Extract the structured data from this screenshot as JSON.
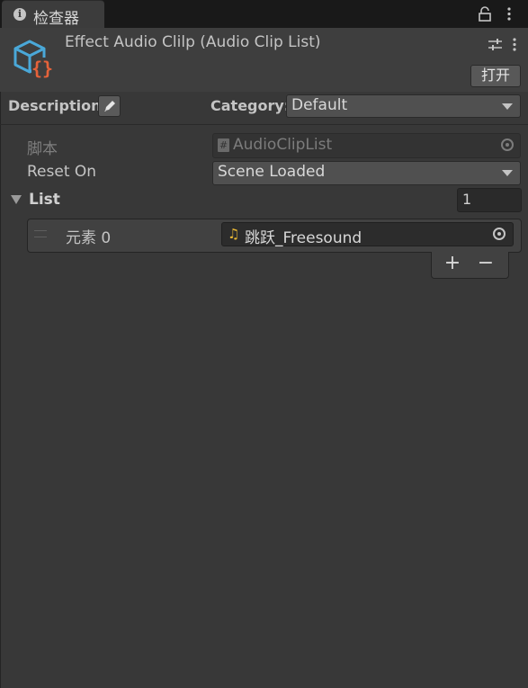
{
  "tab": {
    "label": "检查器",
    "icon": "info-icon"
  },
  "header": {
    "title": "Effect Audio Clilp (Audio Clip List)",
    "open_label": "打开",
    "icon": "script-object-icon"
  },
  "description": {
    "label": "Description"
  },
  "category": {
    "label": "Category:",
    "value": "Default"
  },
  "properties": {
    "script": {
      "label": "脚本",
      "value": "AudioClipList"
    },
    "reset_on": {
      "label": "Reset On",
      "value": "Scene Loaded"
    }
  },
  "list": {
    "label": "List",
    "size": "1",
    "items": [
      {
        "label": "元素 0",
        "value": "跳跃_Freesound"
      }
    ],
    "add_label": "+",
    "remove_label": "−"
  },
  "colors": {
    "background": "#383838",
    "tabbar": "#191919",
    "script_icon_blue": "#4aa8d8",
    "script_icon_orange": "#e5623a",
    "audio_icon": "#e7b634"
  }
}
